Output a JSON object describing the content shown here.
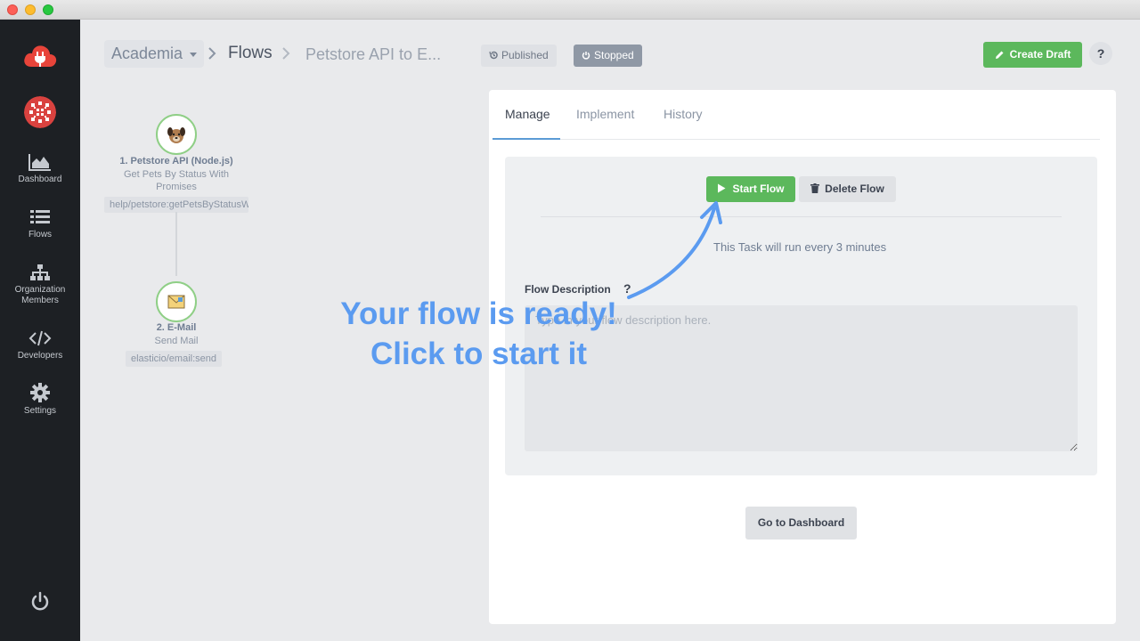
{
  "breadcrumb": {
    "account": "Academia",
    "flows": "Flows",
    "current": "Petstore API to E..."
  },
  "status": {
    "published": "Published",
    "stopped": "Stopped"
  },
  "header": {
    "create_draft": "Create Draft",
    "help": "?"
  },
  "sidebar": {
    "items": [
      {
        "label": "Dashboard",
        "icon": "area-chart-icon"
      },
      {
        "label": "Flows",
        "icon": "list-icon"
      },
      {
        "label": "Organization Members",
        "icon": "org-chart-icon"
      },
      {
        "label": "Developers",
        "icon": "code-icon"
      },
      {
        "label": "Settings",
        "icon": "gear-icon"
      }
    ]
  },
  "flow": {
    "nodes": [
      {
        "title": "1. Petstore API (Node.js)",
        "sub1": "Get Pets By Status With",
        "sub2": "Promises",
        "chip": "help/petstore:getPetsByStatusWithPromises",
        "icon": "dog-icon"
      },
      {
        "title": "2. E-Mail",
        "sub1": "Send Mail",
        "chip": "elasticio/email:send",
        "icon": "envelope-icon"
      }
    ]
  },
  "panel": {
    "tabs": [
      "Manage",
      "Implement",
      "History"
    ],
    "active_tab": "Manage",
    "start_flow": "Start Flow",
    "delete_flow": "Delete Flow",
    "schedule": "This Task will run every 3 minutes",
    "description_label": "Flow Description",
    "description_help": "?",
    "description_placeholder": "Type in your flow description here.",
    "go_dashboard": "Go to Dashboard"
  },
  "callout": {
    "line1": "Your flow is ready!",
    "line2": "Click to start it"
  },
  "colors": {
    "accent_green": "#5cb85c",
    "accent_blue": "#5b9bf0",
    "sidebar_bg": "#1d2024",
    "brand_red": "#e8443a"
  }
}
